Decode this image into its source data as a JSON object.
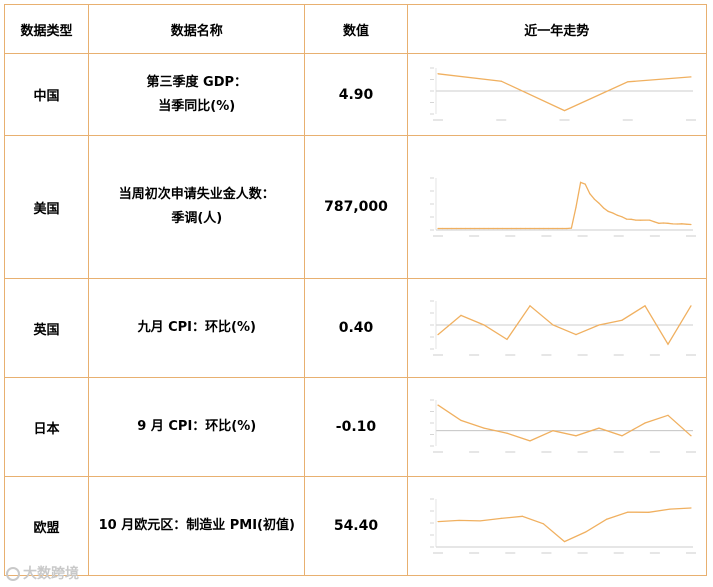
{
  "headers": {
    "type": "数据类型",
    "name": "数据名称",
    "value": "数值",
    "trend": "近一年走势"
  },
  "rows": [
    {
      "country": "中国",
      "name_line1": "第三季度 GDP：",
      "name_line2": "当季同比(%)",
      "value": "4.90",
      "chart_data": {
        "type": "line",
        "color": "#f0b060",
        "values": [
          6.0,
          3.4,
          -6.8,
          3.2,
          4.9
        ],
        "ylim": [
          -8,
          8
        ]
      }
    },
    {
      "country": "美国",
      "name_line1": "当周初次申请失业金人数：",
      "name_line2": "季调(人)",
      "value": "787,000",
      "chart_data": {
        "type": "line",
        "color": "#f0b060",
        "values": [
          215000,
          212000,
          210000,
          214000,
          211000,
          216000,
          213000,
          218000,
          211000,
          215000,
          212000,
          219000,
          214000,
          211000,
          216000,
          210000,
          212000,
          215000,
          211000,
          214000,
          217000,
          212000,
          216000,
          213000,
          211000,
          214000,
          216000,
          212000,
          215000,
          281000,
          3307000,
          6867000,
          6615000,
          5237000,
          4442000,
          3867000,
          3176000,
          2687000,
          2446000,
          2126000,
          1897000,
          1566000,
          1542000,
          1427000,
          1413000,
          1435000,
          1422000,
          1192000,
          971000,
          1011000,
          963000,
          881000,
          866000,
          898000,
          840000,
          787000
        ],
        "ylim": [
          0,
          7500000
        ]
      }
    },
    {
      "country": "英国",
      "name_line1": "九月 CPI：环比(%)",
      "name_line2": "",
      "value": "0.40",
      "chart_data": {
        "type": "line",
        "color": "#f0b060",
        "values": [
          -0.2,
          0.2,
          0.0,
          -0.3,
          0.4,
          0.0,
          -0.2,
          0.0,
          0.1,
          0.4,
          -0.4,
          0.4
        ],
        "ylim": [
          -0.5,
          0.5
        ]
      }
    },
    {
      "country": "日本",
      "name_line1": "9 月 CPI：环比(%)",
      "name_line2": "",
      "value": "-0.10",
      "chart_data": {
        "type": "line",
        "color": "#f0b060",
        "values": [
          1.0,
          0.4,
          0.1,
          -0.1,
          -0.4,
          0.0,
          -0.2,
          0.1,
          -0.2,
          0.3,
          0.6,
          -0.2
        ],
        "ylim": [
          -0.6,
          1.2
        ]
      }
    },
    {
      "country": "欧盟",
      "name_line1": "10 月欧元区：制造业 PMI(初值)",
      "name_line2": "",
      "value": "54.40",
      "chart_data": {
        "type": "line",
        "color": "#f0b060",
        "values": [
          45.9,
          46.6,
          46.3,
          47.9,
          49.2,
          44.5,
          33.4,
          39.4,
          47.4,
          51.8,
          51.7,
          53.7,
          54.4
        ],
        "ylim": [
          30,
          60
        ]
      }
    }
  ],
  "watermark": "大数跨境"
}
